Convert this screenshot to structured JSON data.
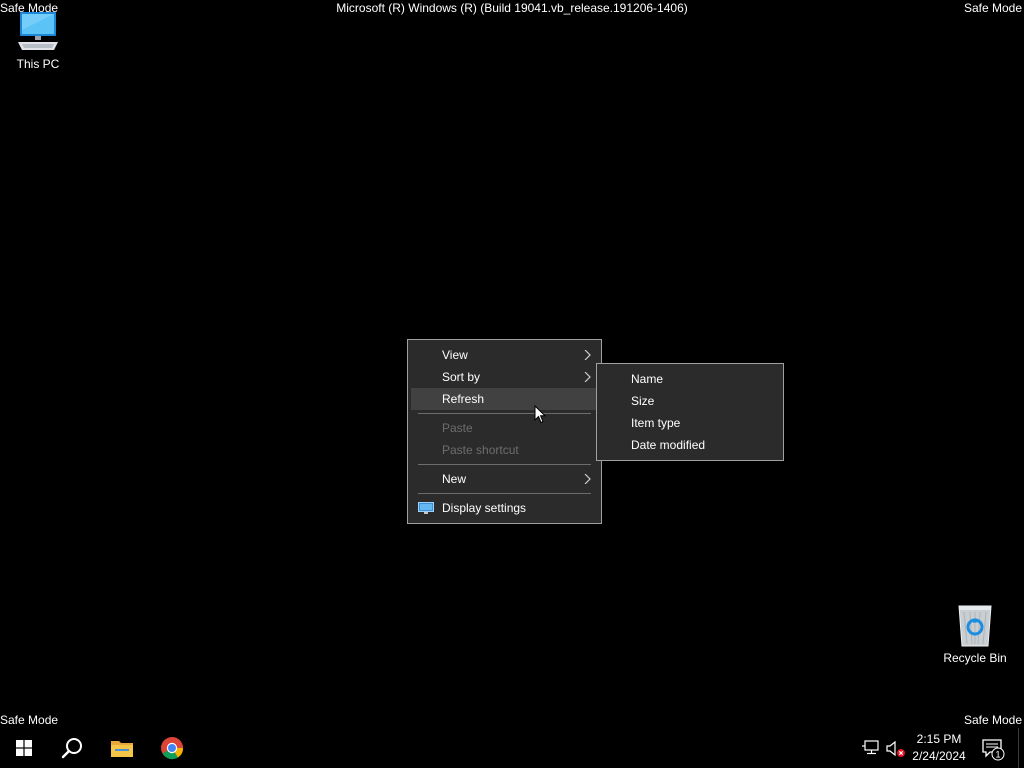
{
  "watermark": {
    "top_left": "Safe Mode",
    "top_right": "Safe Mode",
    "bottom_left": "Safe Mode",
    "bottom_right": "Safe Mode",
    "title": "Microsoft (R) Windows (R) (Build 19041.vb_release.191206-1406)"
  },
  "desktop_icons": {
    "this_pc": {
      "label": "This PC",
      "icon": "computer-icon"
    },
    "recycle_bin": {
      "label": "Recycle Bin",
      "icon": "recycle-bin-icon"
    }
  },
  "context_menu": {
    "items": [
      {
        "label": "View",
        "submenu": true,
        "disabled": false
      },
      {
        "label": "Sort by",
        "submenu": true,
        "disabled": false
      },
      {
        "label": "Refresh",
        "submenu": false,
        "disabled": false,
        "highlighted": true
      },
      {
        "label": "Paste",
        "submenu": false,
        "disabled": true
      },
      {
        "label": "Paste shortcut",
        "submenu": false,
        "disabled": true
      },
      {
        "label": "New",
        "submenu": true,
        "disabled": false
      },
      {
        "label": "Display settings",
        "submenu": false,
        "disabled": false,
        "icon": "display-settings-icon"
      }
    ]
  },
  "sort_submenu": {
    "items": [
      {
        "label": "Name"
      },
      {
        "label": "Size"
      },
      {
        "label": "Item type"
      },
      {
        "label": "Date modified"
      }
    ]
  },
  "taskbar": {
    "start_icon": "windows-logo-icon",
    "search_icon": "search-icon",
    "pinned": [
      "file-explorer-icon",
      "chrome-icon"
    ],
    "tray": [
      "network-icon",
      "volume-muted-icon"
    ],
    "clock": {
      "time": "2:15 PM",
      "date": "2/24/2024"
    },
    "notifications": {
      "icon": "action-center-icon",
      "count": "1"
    }
  },
  "colors": {
    "menu_background": "#2b2b2b",
    "menu_border": "#a0a0a0",
    "menu_highlight": "#414141",
    "disabled_text": "#6d6d6d",
    "desktop_background": "#000000"
  }
}
